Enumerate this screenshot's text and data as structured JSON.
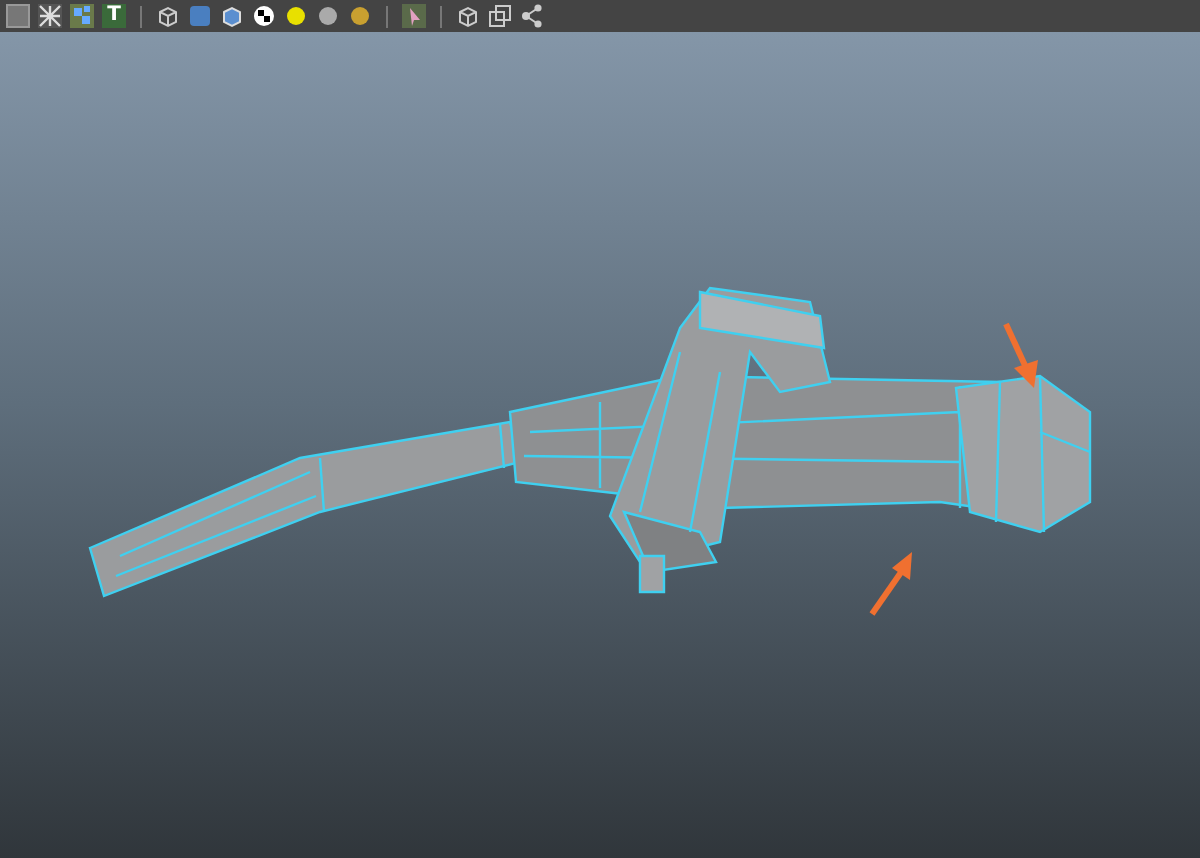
{
  "toolbar": {
    "text_tool_glyph": "T"
  }
}
